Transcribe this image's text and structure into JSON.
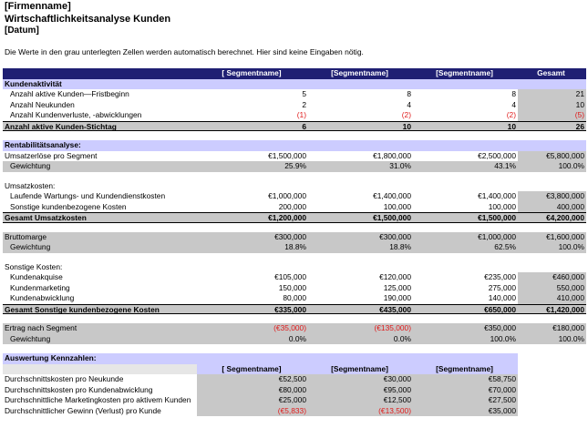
{
  "header": {
    "company": "[Firmenname]",
    "title": "Wirtschaftlichkeitsanalyse Kunden",
    "date": "[Datum]",
    "note": "Die Werte in den grau unterlegten Zellen werden automatisch berechnet. Hier sind keine Eingaben nötig."
  },
  "columns": [
    "[ Segmentname]",
    "[Segmentname]",
    "[Segmentname]",
    "Gesamt"
  ],
  "kunden": {
    "section": "Kundenaktivität",
    "rows": [
      {
        "label": "Anzahl aktive Kunden—Fristbeginn",
        "v": [
          "5",
          "8",
          "8",
          "21"
        ]
      },
      {
        "label": "Anzahl Neukunden",
        "v": [
          "2",
          "4",
          "4",
          "10"
        ]
      },
      {
        "label": "Anzahl Kundenverluste, -abwicklungen",
        "v": [
          "(1)",
          "(2)",
          "(2)",
          "(5)"
        ]
      }
    ],
    "total": {
      "label": "Anzahl aktive Kunden-Stichtag",
      "v": [
        "6",
        "10",
        "10",
        "26"
      ]
    }
  },
  "rent": {
    "section": "Rentabilitätsanalyse:",
    "umsatz": {
      "label": "Umsatzerlöse pro Segment",
      "v": [
        "€1,500,000",
        "€1,800,000",
        "€2,500,000",
        "€5,800,000"
      ]
    },
    "gew1": {
      "label": "Gewichtung",
      "v": [
        "25.9%",
        "31.0%",
        "43.1%",
        "100.0%"
      ]
    },
    "kosten_label": "Umsatzkosten:",
    "k1": {
      "label": "Laufende Wartungs- und Kundendienstkosten",
      "v": [
        "€1,000,000",
        "€1,400,000",
        "€1,400,000",
        "€3,800,000"
      ]
    },
    "k2": {
      "label": "Sonstige kundenbezogene Kosten",
      "v": [
        "200,000",
        "100,000",
        "100,000",
        "400,000"
      ]
    },
    "ktotal": {
      "label": "Gesamt Umsatzkosten",
      "v": [
        "€1,200,000",
        "€1,500,000",
        "€1,500,000",
        "€4,200,000"
      ]
    },
    "brutto": {
      "label": "Bruttomarge",
      "v": [
        "€300,000",
        "€300,000",
        "€1,000,000",
        "€1,600,000"
      ]
    },
    "gew2": {
      "label": "Gewichtung",
      "v": [
        "18.8%",
        "18.8%",
        "62.5%",
        "100.0%"
      ]
    },
    "sonst_label": "Sonstige Kosten:",
    "s1": {
      "label": "Kundenakquise",
      "v": [
        "€105,000",
        "€120,000",
        "€235,000",
        "€460,000"
      ]
    },
    "s2": {
      "label": "Kundenmarketing",
      "v": [
        "150,000",
        "125,000",
        "275,000",
        "550,000"
      ]
    },
    "s3": {
      "label": "Kundenabwicklung",
      "v": [
        "80,000",
        "190,000",
        "140,000",
        "410,000"
      ]
    },
    "stotal": {
      "label": "Gesamt Sonstige kundenbezogene Kosten",
      "v": [
        "€335,000",
        "€435,000",
        "€650,000",
        "€1,420,000"
      ]
    },
    "ertrag": {
      "label": "Ertrag nach Segment",
      "v": [
        "(€35,000)",
        "(€135,000)",
        "€350,000",
        "€180,000"
      ]
    },
    "gew3": {
      "label": "Gewichtung",
      "v": [
        "0.0%",
        "0.0%",
        "100.0%",
        "100.0%"
      ]
    }
  },
  "kpi": {
    "section": "Auswertung Kennzahlen:",
    "cols": [
      "[ Segmentname]",
      "[Segmentname]",
      "[Segmentname]"
    ],
    "rows": [
      {
        "label": "Durchschnittskosten pro Neukunde",
        "v": [
          "€52,500",
          "€30,000",
          "€58,750"
        ]
      },
      {
        "label": "Durchschnittskosten pro Kundenabwicklung",
        "v": [
          "€80,000",
          "€95,000",
          "€70,000"
        ]
      },
      {
        "label": "Durchschnittliche Marketingkosten pro aktivem Kunden",
        "v": [
          "€25,000",
          "€12,500",
          "€27,500"
        ]
      },
      {
        "label": "Durchschnittlicher Gewinn (Verlust) pro Kunde",
        "v": [
          "(€5,833)",
          "(€13,500)",
          "€35,000"
        ]
      }
    ]
  }
}
